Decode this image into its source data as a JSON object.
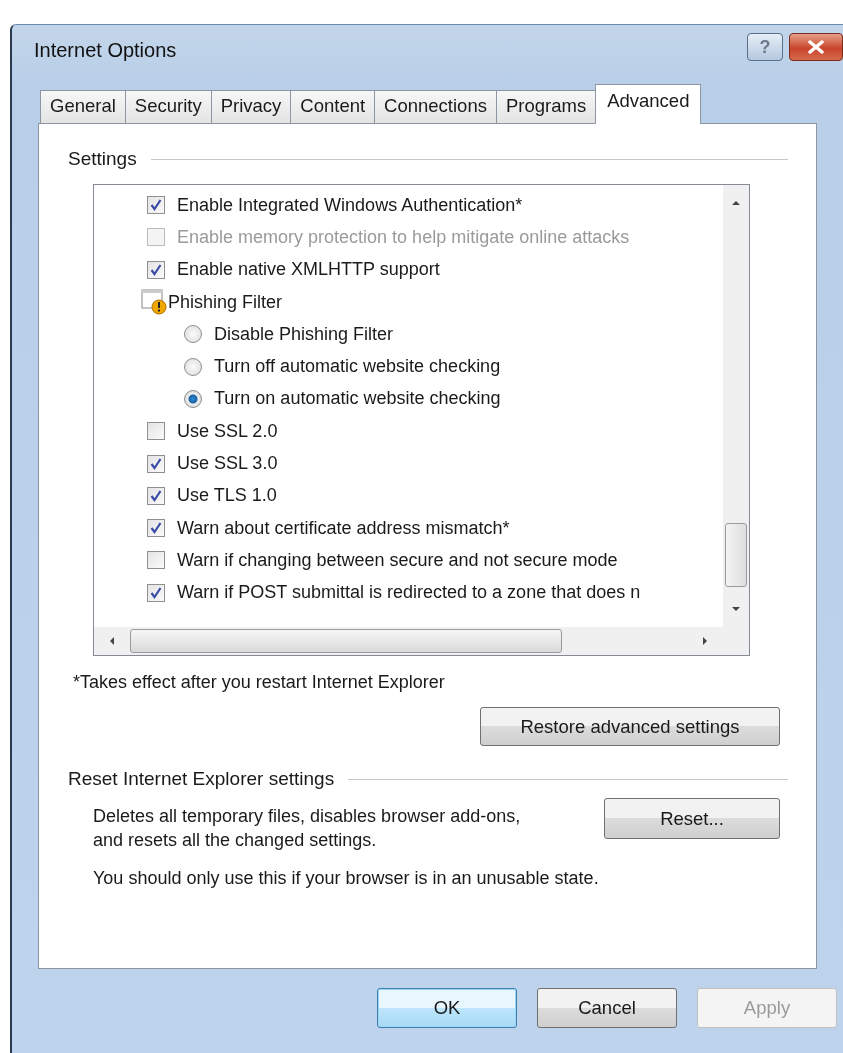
{
  "window": {
    "title": "Internet Options",
    "help_button": "?"
  },
  "tabs": [
    {
      "label": "General",
      "selected": false
    },
    {
      "label": "Security",
      "selected": false
    },
    {
      "label": "Privacy",
      "selected": false
    },
    {
      "label": "Content",
      "selected": false
    },
    {
      "label": "Connections",
      "selected": false
    },
    {
      "label": "Programs",
      "selected": false
    },
    {
      "label": "Advanced",
      "selected": true
    }
  ],
  "settings": {
    "label": "Settings",
    "items": [
      {
        "kind": "checkbox",
        "label": "Enable Integrated Windows Authentication*",
        "checked": true,
        "disabled": false
      },
      {
        "kind": "checkbox",
        "label": "Enable memory protection to help mitigate online attacks",
        "checked": false,
        "disabled": true
      },
      {
        "kind": "checkbox",
        "label": "Enable native XMLHTTP support",
        "checked": true,
        "disabled": false
      },
      {
        "kind": "group",
        "label": "Phishing Filter"
      },
      {
        "kind": "radio",
        "label": "Disable Phishing Filter",
        "selected": false
      },
      {
        "kind": "radio",
        "label": "Turn off automatic website checking",
        "selected": false
      },
      {
        "kind": "radio",
        "label": "Turn on automatic website checking",
        "selected": true
      },
      {
        "kind": "checkbox",
        "label": "Use SSL 2.0",
        "checked": false,
        "disabled": false
      },
      {
        "kind": "checkbox",
        "label": "Use SSL 3.0",
        "checked": true,
        "disabled": false
      },
      {
        "kind": "checkbox",
        "label": "Use TLS 1.0",
        "checked": true,
        "disabled": false
      },
      {
        "kind": "checkbox",
        "label": "Warn about certificate address mismatch*",
        "checked": true,
        "disabled": false
      },
      {
        "kind": "checkbox",
        "label": "Warn if changing between secure and not secure mode",
        "checked": false,
        "disabled": false
      },
      {
        "kind": "checkbox",
        "label": "Warn if POST submittal is redirected to a zone that does n",
        "checked": true,
        "disabled": false
      }
    ],
    "footnote": "*Takes effect after you restart Internet Explorer",
    "restore_button": "Restore advanced settings"
  },
  "reset_section": {
    "label": "Reset Internet Explorer settings",
    "description": "Deletes all temporary files, disables browser add-ons, and resets all the changed settings.",
    "reset_button": "Reset...",
    "warning": "You should only use this if your browser is in an unusable state."
  },
  "buttons": [
    {
      "label": "OK",
      "default": true,
      "disabled": false
    },
    {
      "label": "Cancel",
      "default": false,
      "disabled": false
    },
    {
      "label": "Apply",
      "default": false,
      "disabled": true
    }
  ]
}
